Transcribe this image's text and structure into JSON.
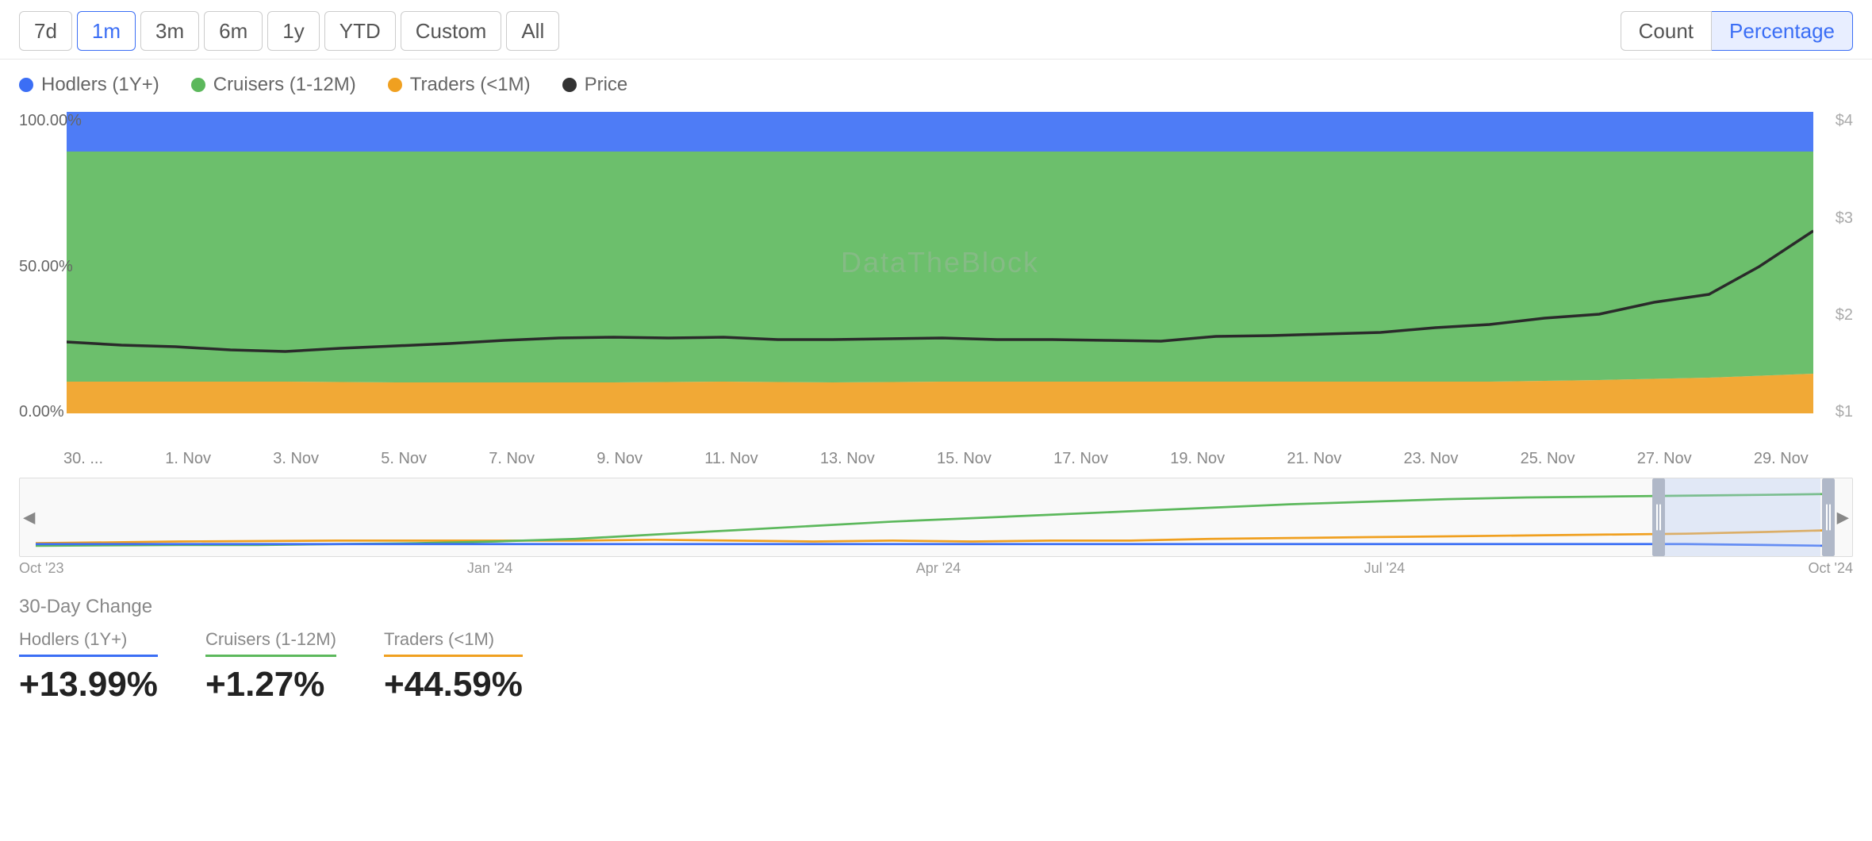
{
  "toolbar": {
    "time_buttons": [
      {
        "label": "7d",
        "id": "7d",
        "active": false
      },
      {
        "label": "1m",
        "id": "1m",
        "active": true
      },
      {
        "label": "3m",
        "id": "3m",
        "active": false
      },
      {
        "label": "6m",
        "id": "6m",
        "active": false
      },
      {
        "label": "1y",
        "id": "1y",
        "active": false
      },
      {
        "label": "YTD",
        "id": "ytd",
        "active": false
      },
      {
        "label": "Custom",
        "id": "custom",
        "active": false
      },
      {
        "label": "All",
        "id": "all",
        "active": false
      }
    ],
    "view_count_label": "Count",
    "view_percentage_label": "Percentage"
  },
  "legend": [
    {
      "label": "Hodlers (1Y+)",
      "color": "#3b6ef5"
    },
    {
      "label": "Cruisers (1-12M)",
      "color": "#5cb85c"
    },
    {
      "label": "Traders (<1M)",
      "color": "#f0a020"
    },
    {
      "label": "Price",
      "color": "#333"
    }
  ],
  "chart": {
    "y_axis_left": [
      "100.00%",
      "50.00%",
      "0.00%"
    ],
    "y_axis_right": [
      "$4",
      "$3",
      "$2",
      "$1"
    ],
    "watermark": "DataTheBlock",
    "x_axis_labels": [
      "30. ...",
      "1. Nov",
      "3. Nov",
      "5. Nov",
      "7. Nov",
      "9. Nov",
      "11. Nov",
      "13. Nov",
      "15. Nov",
      "17. Nov",
      "19. Nov",
      "21. Nov",
      "23. Nov",
      "25. Nov",
      "27. Nov",
      "29. Nov"
    ]
  },
  "navigator": {
    "x_labels": [
      "Oct '23",
      "Jan '24",
      "Apr '24",
      "Jul '24",
      "Oct '24"
    ]
  },
  "stats": {
    "title": "30-Day Change",
    "items": [
      {
        "label": "Hodlers (1Y+)",
        "value": "+13.99%",
        "class": "hodlers"
      },
      {
        "label": "Cruisers (1-12M)",
        "value": "+1.27%",
        "class": "cruisers"
      },
      {
        "label": "Traders (<1M)",
        "value": "+44.59%",
        "class": "traders"
      }
    ]
  },
  "colors": {
    "hodlers": "#3b6ef5",
    "cruisers": "#5cb85c",
    "traders": "#f0a020",
    "price_line": "#2a2a2a"
  }
}
